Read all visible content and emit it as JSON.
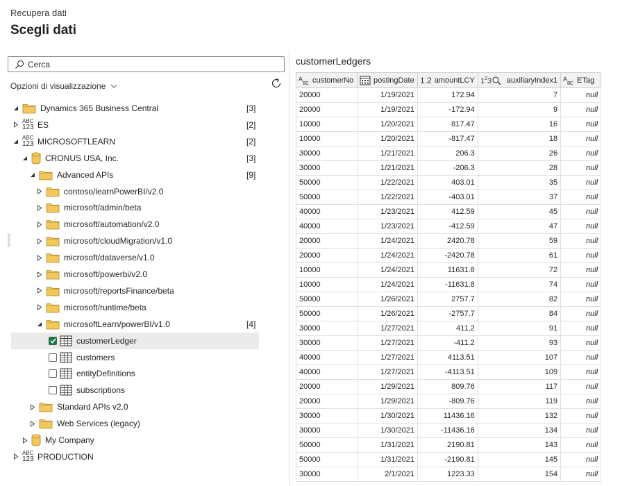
{
  "header": {
    "subtitle": "Recupera dati",
    "title": "Scegli dati"
  },
  "search": {
    "placeholder": "Cerca"
  },
  "view_options": {
    "label": "Opzioni di visualizzazione"
  },
  "tree": [
    {
      "label": "Dynamics 365 Business Central",
      "count": "[3]",
      "icon": "folder-icon",
      "indent": 0,
      "expanded": true
    },
    {
      "label": "ES",
      "count": "[2]",
      "icon": "abc-123-icon",
      "indent": 0,
      "expanded": false
    },
    {
      "label": "MICROSOFTLEARN",
      "count": "[2]",
      "icon": "abc-123-icon",
      "indent": 0,
      "expanded": true
    },
    {
      "label": "CRONUS USA, Inc.",
      "count": "[3]",
      "icon": "database-icon",
      "indent": 1,
      "expanded": true
    },
    {
      "label": "Advanced APIs",
      "count": "[9]",
      "icon": "folder-icon",
      "indent": 2,
      "expanded": true
    },
    {
      "label": "contoso/learnPowerBI/v2.0",
      "count": "",
      "icon": "folder-icon",
      "indent": 3,
      "expanded": false
    },
    {
      "label": "microsoft/admin/beta",
      "count": "",
      "icon": "folder-icon",
      "indent": 3,
      "expanded": false
    },
    {
      "label": "microsoft/automation/v2.0",
      "count": "",
      "icon": "folder-icon",
      "indent": 3,
      "expanded": false
    },
    {
      "label": "microsoft/cloudMigration/v1.0",
      "count": "",
      "icon": "folder-icon",
      "indent": 3,
      "expanded": false
    },
    {
      "label": "microsoft/dataverse/v1.0",
      "count": "",
      "icon": "folder-icon",
      "indent": 3,
      "expanded": false
    },
    {
      "label": "microsoft/powerbi/v2.0",
      "count": "",
      "icon": "folder-icon",
      "indent": 3,
      "expanded": false
    },
    {
      "label": "microsoft/reportsFinance/beta",
      "count": "",
      "icon": "folder-icon",
      "indent": 3,
      "expanded": false
    },
    {
      "label": "microsoft/runtime/beta",
      "count": "",
      "icon": "folder-icon",
      "indent": 3,
      "expanded": false
    },
    {
      "label": "microsoftLearn/powerBI/v1.0",
      "count": "[4]",
      "icon": "folder-icon",
      "indent": 3,
      "expanded": true
    },
    {
      "label": "customerLedger",
      "count": "",
      "icon": "table-icon",
      "indent": 4,
      "checkbox": true,
      "checked": true,
      "selected": true
    },
    {
      "label": "customers",
      "count": "",
      "icon": "table-icon",
      "indent": 4,
      "checkbox": true,
      "checked": false
    },
    {
      "label": "entityDefinitions",
      "count": "",
      "icon": "table-icon",
      "indent": 4,
      "checkbox": true,
      "checked": false
    },
    {
      "label": "subscriptions",
      "count": "",
      "icon": "table-icon",
      "indent": 4,
      "checkbox": true,
      "checked": false
    },
    {
      "label": "Standard APIs v2.0",
      "count": "",
      "icon": "folder-icon",
      "indent": 2,
      "expanded": false
    },
    {
      "label": "Web Services (legacy)",
      "count": "",
      "icon": "folder-icon",
      "indent": 2,
      "expanded": false
    },
    {
      "label": "My Company",
      "count": "",
      "icon": "database-icon",
      "indent": 1,
      "expanded": false
    },
    {
      "label": "PRODUCTION",
      "count": "",
      "icon": "abc-123-icon",
      "indent": 0,
      "expanded": false
    }
  ],
  "preview": {
    "title": "customerLedgers",
    "columns": [
      {
        "name": "customerNo",
        "type_icon": "text-type-icon"
      },
      {
        "name": "postingDate",
        "type_icon": "date-type-icon"
      },
      {
        "name": "amountLCY",
        "type_icon": "decimal-type-icon"
      },
      {
        "name": "auxiliaryIndex1",
        "type_icon": "integer-type-icon"
      },
      {
        "name": "ETag",
        "type_icon": "text-type-icon"
      }
    ],
    "rows": [
      [
        "20000",
        "1/19/2021",
        "172.94",
        "7",
        "null"
      ],
      [
        "20000",
        "1/19/2021",
        "-172.94",
        "9",
        "null"
      ],
      [
        "10000",
        "1/20/2021",
        "817.47",
        "16",
        "null"
      ],
      [
        "10000",
        "1/20/2021",
        "-817.47",
        "18",
        "null"
      ],
      [
        "30000",
        "1/21/2021",
        "206.3",
        "26",
        "null"
      ],
      [
        "30000",
        "1/21/2021",
        "-206.3",
        "28",
        "null"
      ],
      [
        "50000",
        "1/22/2021",
        "403.01",
        "35",
        "null"
      ],
      [
        "50000",
        "1/22/2021",
        "-403.01",
        "37",
        "null"
      ],
      [
        "40000",
        "1/23/2021",
        "412.59",
        "45",
        "null"
      ],
      [
        "40000",
        "1/23/2021",
        "-412.59",
        "47",
        "null"
      ],
      [
        "20000",
        "1/24/2021",
        "2420.78",
        "59",
        "null"
      ],
      [
        "20000",
        "1/24/2021",
        "-2420.78",
        "61",
        "null"
      ],
      [
        "10000",
        "1/24/2021",
        "11631.8",
        "72",
        "null"
      ],
      [
        "10000",
        "1/24/2021",
        "-11631.8",
        "74",
        "null"
      ],
      [
        "50000",
        "1/26/2021",
        "2757.7",
        "82",
        "null"
      ],
      [
        "50000",
        "1/26/2021",
        "-2757.7",
        "84",
        "null"
      ],
      [
        "30000",
        "1/27/2021",
        "411.2",
        "91",
        "null"
      ],
      [
        "30000",
        "1/27/2021",
        "-411.2",
        "93",
        "null"
      ],
      [
        "40000",
        "1/27/2021",
        "4113.51",
        "107",
        "null"
      ],
      [
        "40000",
        "1/27/2021",
        "-4113.51",
        "109",
        "null"
      ],
      [
        "20000",
        "1/29/2021",
        "809.76",
        "117",
        "null"
      ],
      [
        "20000",
        "1/29/2021",
        "-809.76",
        "119",
        "null"
      ],
      [
        "30000",
        "1/30/2021",
        "11436.16",
        "132",
        "null"
      ],
      [
        "30000",
        "1/30/2021",
        "-11436.16",
        "134",
        "null"
      ],
      [
        "50000",
        "1/31/2021",
        "2190.81",
        "143",
        "null"
      ],
      [
        "50000",
        "1/31/2021",
        "-2190.81",
        "145",
        "null"
      ],
      [
        "30000",
        "2/1/2021",
        "1223.33",
        "154",
        "null"
      ]
    ]
  },
  "colors": {
    "folder": "#f2c85b",
    "folder_stroke": "#b08a2e",
    "database": "#f2c85b",
    "check": "#217346",
    "selected_row": "#edebe9"
  }
}
